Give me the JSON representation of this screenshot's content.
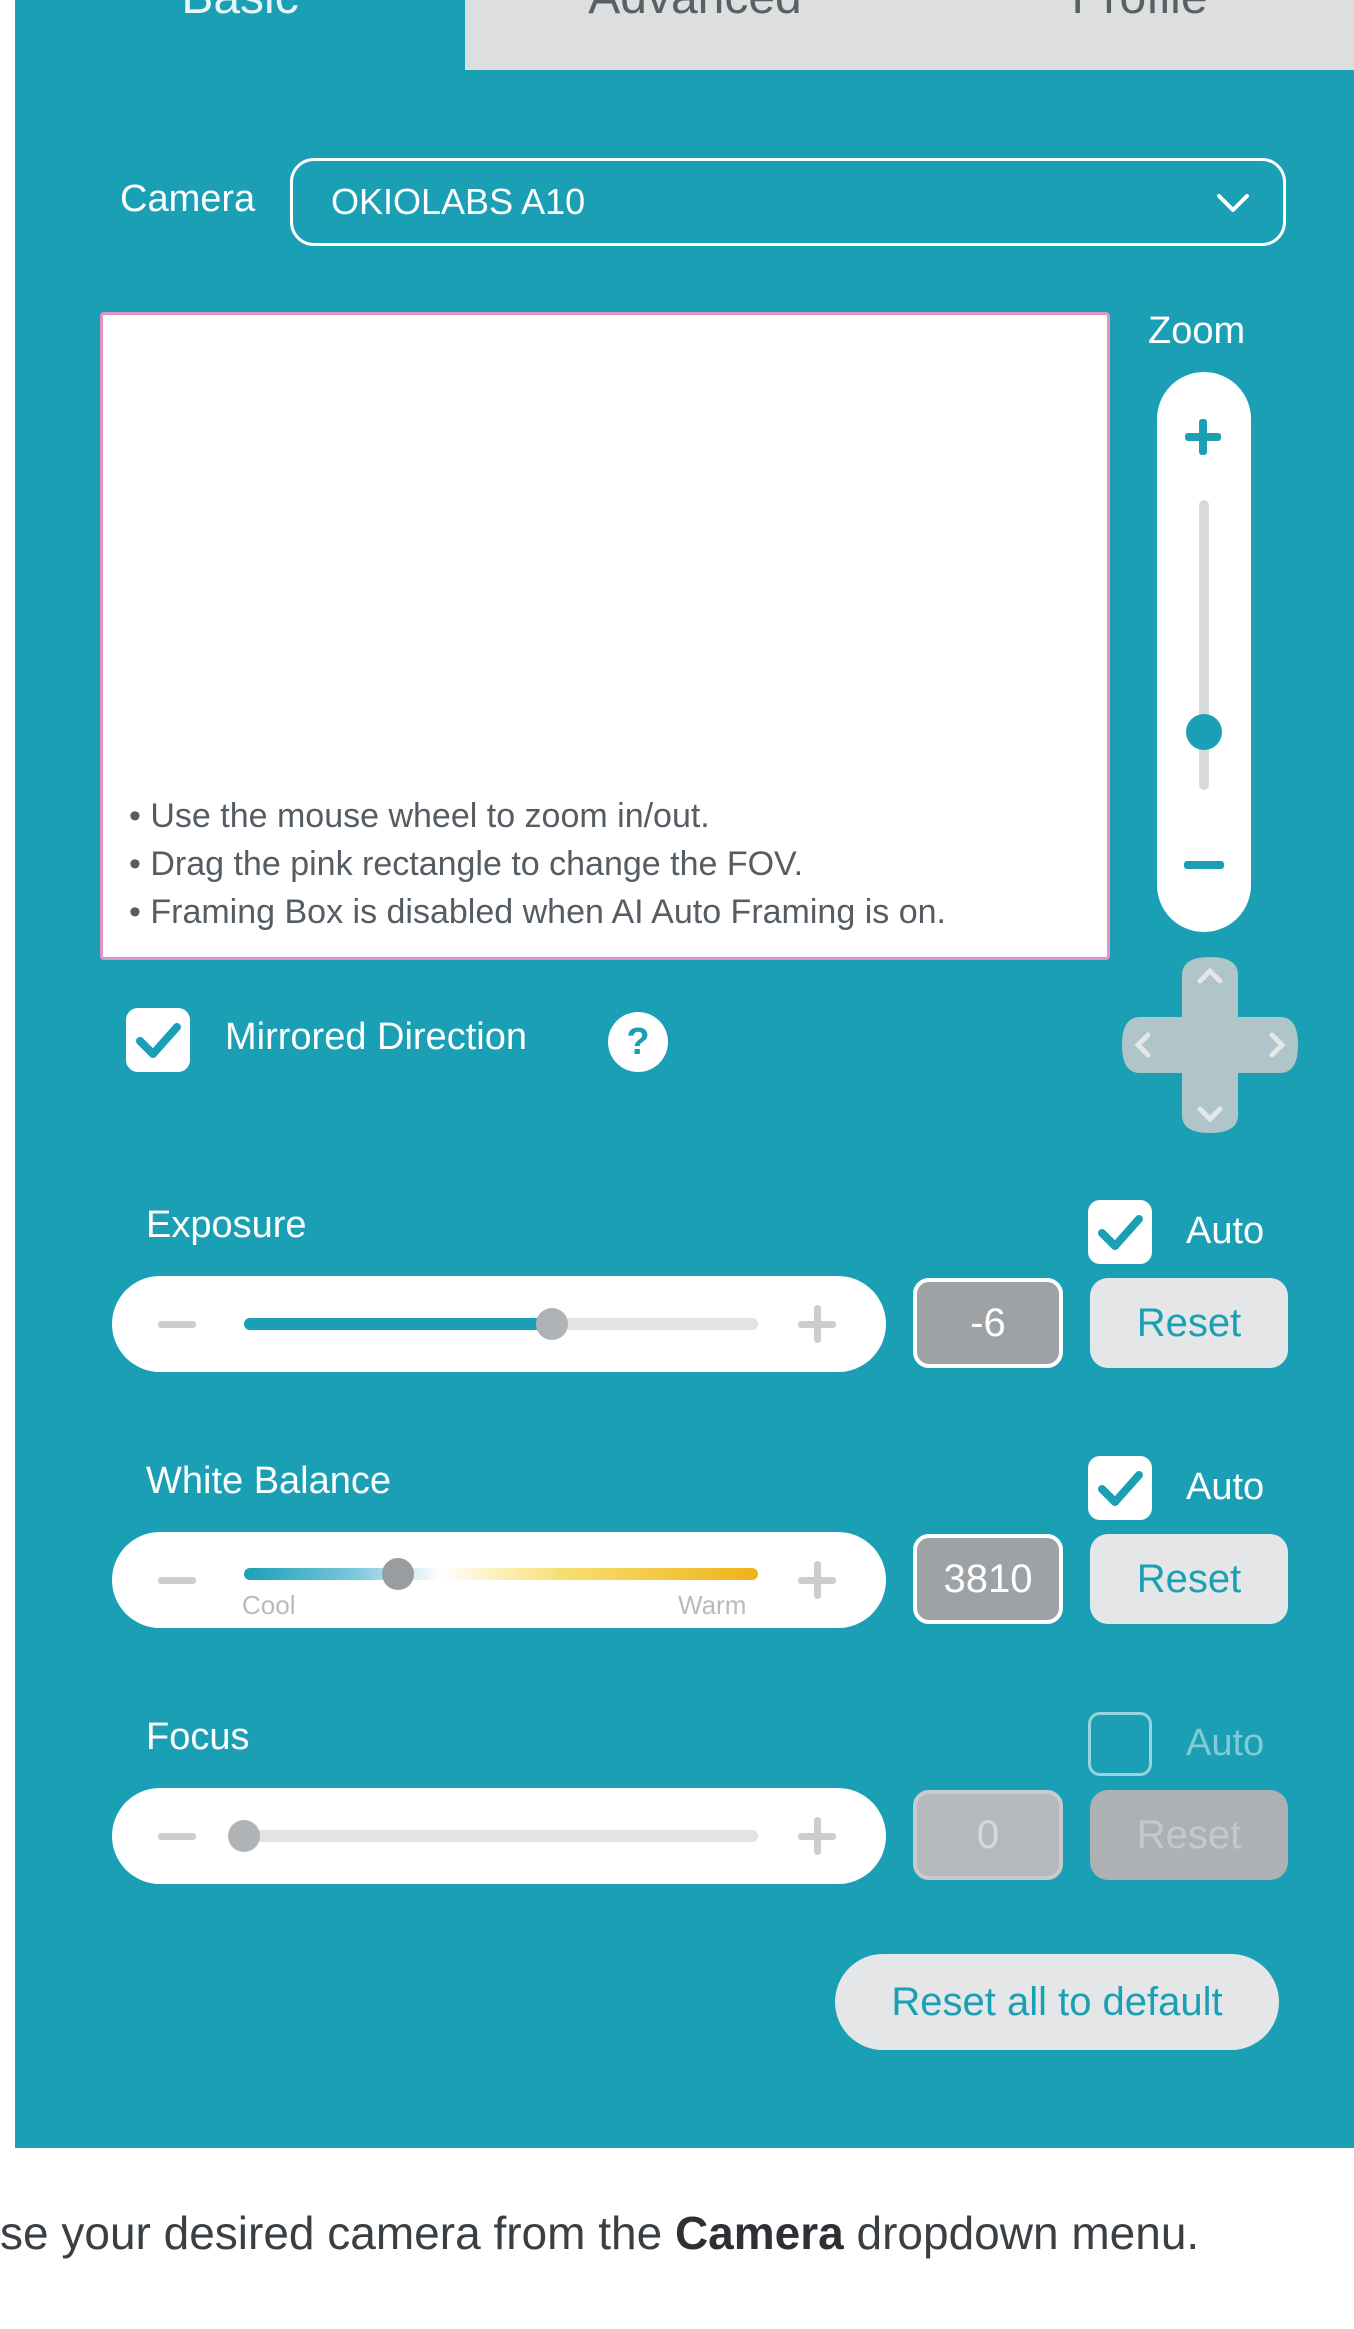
{
  "tabs": [
    {
      "label": "Basic",
      "active": true
    },
    {
      "label": "Advanced",
      "active": false
    },
    {
      "label": "Profile",
      "active": false
    }
  ],
  "camera": {
    "label": "Camera",
    "selected": "OKIOLABS A10",
    "icon": "chevron-down-icon"
  },
  "preview": {
    "hints": [
      "• Use the mouse wheel to zoom in/out.",
      "• Drag the pink rectangle to change the FOV.",
      "• Framing Box is disabled when AI Auto Framing is on."
    ],
    "border_color": "#e493c7"
  },
  "zoom": {
    "label": "Zoom",
    "level": 0.2
  },
  "mirrored": {
    "label": "Mirrored Direction",
    "checked": true,
    "help_icon": "?"
  },
  "exposure": {
    "label": "Exposure",
    "auto_label": "Auto",
    "auto": true,
    "value": "-6",
    "reset_label": "Reset",
    "level": 0.6
  },
  "white_balance": {
    "label": "White Balance",
    "auto_label": "Auto",
    "auto": true,
    "value": "3810",
    "reset_label": "Reset",
    "cool_label": "Cool",
    "warm_label": "Warm",
    "level": 0.3
  },
  "focus": {
    "label": "Focus",
    "auto_label": "Auto",
    "auto": false,
    "value": "0",
    "reset_label": "Reset",
    "level": 0.0
  },
  "reset_all_label": "Reset all to default",
  "caption": {
    "prefix": "se your desired camera from the ",
    "bold": "Camera",
    "suffix": " dropdown menu."
  },
  "colors": {
    "panel": "#1b9fb5",
    "tab_inactive": "#dddede",
    "accent": "#1b9fb5",
    "pink": "#e493c7"
  }
}
